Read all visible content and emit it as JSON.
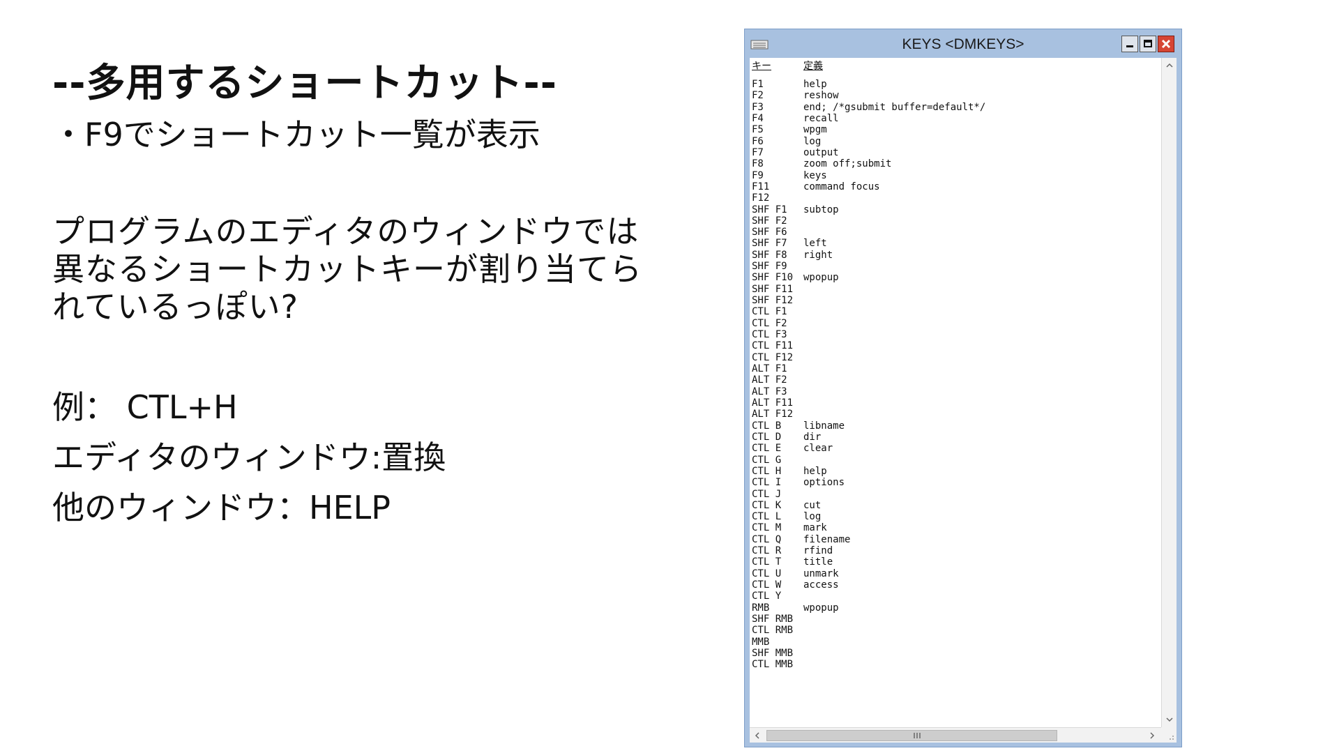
{
  "slide": {
    "heading": "--多用するショートカット--",
    "subline": "・F9でショートカット一覧が表示",
    "paragraph_lines": [
      "プログラムのエディタのウィンドウでは",
      "異なるショートカットキーが割り当てら",
      "れているっぽい?"
    ],
    "examples": [
      "例： CTL+H",
      "エディタのウィンドウ:置換",
      "他のウィンドウ：HELP"
    ]
  },
  "window": {
    "title": "KEYS <DMKEYS>",
    "controls": [
      "minimize",
      "maximize",
      "close"
    ],
    "headers": {
      "key": "キー",
      "definition": "定義"
    },
    "rows": [
      {
        "key": "F1",
        "def": "help"
      },
      {
        "key": "F2",
        "def": "reshow"
      },
      {
        "key": "F3",
        "def": "end; /*gsubmit buffer=default*/"
      },
      {
        "key": "F4",
        "def": "recall"
      },
      {
        "key": "F5",
        "def": "wpgm"
      },
      {
        "key": "F6",
        "def": "log"
      },
      {
        "key": "F7",
        "def": "output"
      },
      {
        "key": "F8",
        "def": "zoom off;submit"
      },
      {
        "key": "F9",
        "def": "keys"
      },
      {
        "key": "F11",
        "def": "command focus"
      },
      {
        "key": "F12",
        "def": ""
      },
      {
        "key": "SHF F1",
        "def": "subtop"
      },
      {
        "key": "SHF F2",
        "def": ""
      },
      {
        "key": "SHF F6",
        "def": ""
      },
      {
        "key": "SHF F7",
        "def": "left"
      },
      {
        "key": "SHF F8",
        "def": "right"
      },
      {
        "key": "SHF F9",
        "def": ""
      },
      {
        "key": "SHF F10",
        "def": "wpopup"
      },
      {
        "key": "SHF F11",
        "def": ""
      },
      {
        "key": "SHF F12",
        "def": ""
      },
      {
        "key": "CTL F1",
        "def": ""
      },
      {
        "key": "CTL F2",
        "def": ""
      },
      {
        "key": "CTL F3",
        "def": ""
      },
      {
        "key": "CTL F11",
        "def": ""
      },
      {
        "key": "CTL F12",
        "def": ""
      },
      {
        "key": "ALT F1",
        "def": ""
      },
      {
        "key": "ALT F2",
        "def": ""
      },
      {
        "key": "ALT F3",
        "def": ""
      },
      {
        "key": "ALT F11",
        "def": ""
      },
      {
        "key": "ALT F12",
        "def": ""
      },
      {
        "key": "CTL B",
        "def": "libname"
      },
      {
        "key": "CTL D",
        "def": "dir"
      },
      {
        "key": "CTL E",
        "def": "clear"
      },
      {
        "key": "CTL G",
        "def": ""
      },
      {
        "key": "CTL H",
        "def": "help"
      },
      {
        "key": "CTL I",
        "def": "options"
      },
      {
        "key": "CTL J",
        "def": ""
      },
      {
        "key": "CTL K",
        "def": "cut"
      },
      {
        "key": "CTL L",
        "def": "log"
      },
      {
        "key": "CTL M",
        "def": "mark"
      },
      {
        "key": "CTL Q",
        "def": "filename"
      },
      {
        "key": "CTL R",
        "def": "rfind"
      },
      {
        "key": "CTL T",
        "def": "title"
      },
      {
        "key": "CTL U",
        "def": "unmark"
      },
      {
        "key": "CTL W",
        "def": "access"
      },
      {
        "key": "CTL Y",
        "def": ""
      },
      {
        "key": "RMB",
        "def": "wpopup"
      },
      {
        "key": "SHF RMB",
        "def": ""
      },
      {
        "key": "CTL RMB",
        "def": ""
      },
      {
        "key": "MMB",
        "def": ""
      },
      {
        "key": "SHF MMB",
        "def": ""
      },
      {
        "key": "CTL MMB",
        "def": ""
      }
    ],
    "scrollbar": {
      "up_icon": "chevron-up-icon",
      "down_icon": "chevron-down-icon",
      "left_icon": "chevron-left-icon",
      "right_icon": "chevron-right-icon",
      "vertical_thumb_fraction": 1.0,
      "horizontal_thumb_fraction": 0.77
    },
    "colors": {
      "frame": "#a8c1e0",
      "close": "#d64534",
      "client": "#ffffff"
    }
  }
}
